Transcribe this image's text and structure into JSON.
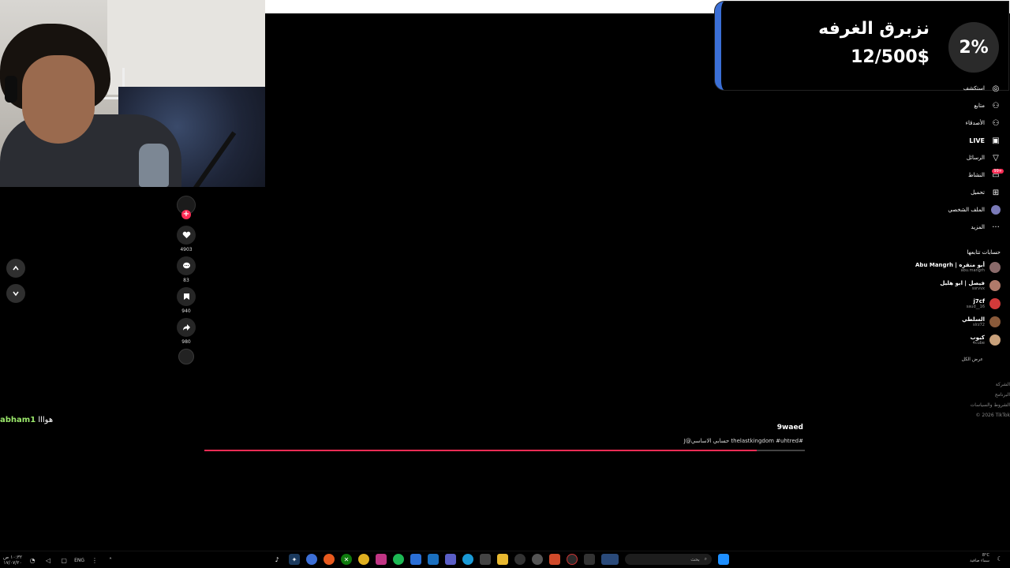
{
  "goal": {
    "title": "نزبرق الغرفه",
    "amount": "12/500$",
    "percent": "2%",
    "bar_color": "#3b6fd6"
  },
  "actions": {
    "likes": "4903",
    "comments": "83",
    "saves": "940",
    "shares": "980"
  },
  "chat": {
    "user": "abham1",
    "message": "هوااا"
  },
  "video": {
    "username": "9waed",
    "caption": "#thelastkingdom #uhtred حسابي الاساسي@J",
    "progress": 0.92,
    "accent": "#fe2c55"
  },
  "sidebar": {
    "nav": [
      {
        "label": "استكشف",
        "icon": "compass-icon",
        "glyph": "◎"
      },
      {
        "label": "متابع",
        "icon": "following-icon",
        "glyph": "⚇"
      },
      {
        "label": "الأصدقاء",
        "icon": "friends-icon",
        "glyph": "⚇"
      },
      {
        "label": "LIVE",
        "icon": "live-icon",
        "glyph": "▣"
      },
      {
        "label": "الرسائل",
        "icon": "messages-icon",
        "glyph": "▽"
      },
      {
        "label": "النشاط",
        "icon": "activity-icon",
        "glyph": "▭",
        "badge": "99+"
      },
      {
        "label": "تحميل",
        "icon": "upload-icon",
        "glyph": "⊞"
      },
      {
        "label": "الملف الشخصي",
        "icon": "profile-icon",
        "glyph": ""
      },
      {
        "label": "المزيد",
        "icon": "more-icon",
        "glyph": "···"
      }
    ],
    "following_heading": "حسابات تتابعها",
    "accounts": [
      {
        "name": "Abu Mangrh | أبو منقره",
        "handle": "abu.mangrh",
        "color": "#8a6a6a"
      },
      {
        "name": "فيصل | ابو هليل",
        "handle": "ssrvvx",
        "color": "#b07a6a"
      },
      {
        "name": "j7cf",
        "handle": "saud__16",
        "color": "#d23a3a"
      },
      {
        "name": "السلطي",
        "handle": "slrz72",
        "color": "#8a5a3a"
      },
      {
        "name": "كيوب",
        "handle": "4cube",
        "color": "#c8a07a"
      }
    ],
    "show_all": "عرض الكل",
    "footer": [
      "الشركة",
      "البرنامج",
      "الشروط والسياسات",
      "© 2026 TikTok"
    ]
  },
  "taskbar": {
    "time": "١٠:٣٢ ص",
    "date": "١٧/٠٧/٢٠",
    "lang": "ENG",
    "search_placeholder": "بحث",
    "weather_temp": "8°C",
    "weather_desc": "سماء صافية"
  }
}
